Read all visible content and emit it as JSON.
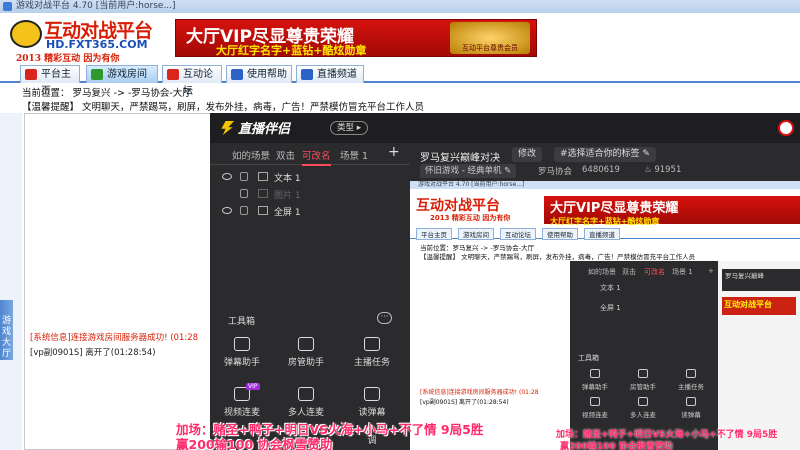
{
  "window": {
    "title": "游戏对战平台 4.70 [当前用户:horse...]"
  },
  "banner": {
    "logo_text": "互动对战平台",
    "logo_url": "HD.FXT365.COM",
    "logo_slogan": "2013 精彩互动 因为有你",
    "ad_line1": "大厅VIP尽显尊贵荣耀",
    "ad_line2": "大厅红字名字+蓝钻+酷炫勋章",
    "ad_badge": "互动平台尊贵会员"
  },
  "nav": {
    "tabs": [
      {
        "label": "平台主页",
        "color": "#d8261f"
      },
      {
        "label": "游戏房间",
        "color": "#2e9a2e",
        "active": true
      },
      {
        "label": "互动论坛",
        "color": "#d8261f"
      },
      {
        "label": "使用帮助",
        "color": "#2a62c6"
      },
      {
        "label": "直播频道",
        "color": "#2a62c6"
      }
    ]
  },
  "breadcrumb": "当前位置：  罗马复兴  ->  -罗马协会-大厅",
  "notice": "【温馨提醒】 文明聊天，严禁踢骂，刷屏，发布外挂，病毒，广告！严禁模仿冒充平台工作人员",
  "sidetab": "游戏大厅",
  "chat": {
    "system_msg": "[系统信息]连接游戏房间服务器成功! (01:28",
    "exit_msg": "[vp副0901S] 离开了(01:28:54)"
  },
  "overlay": {
    "app_name": "直播伴侣",
    "type_button": "类型 ▸",
    "scene_tabs": [
      "如的场景",
      "双击",
      "可改名",
      "场景 1"
    ],
    "add_scene": "+",
    "sources": [
      {
        "label": "文本 1",
        "dim": false
      },
      {
        "label": "图片 1",
        "dim": true
      },
      {
        "label": "全屏 1",
        "dim": false
      }
    ],
    "toolbox_label": "工具箱",
    "toolbox_more": "···",
    "tools": [
      "弹幕助手",
      "房管助手",
      "主播任务",
      "视频连麦",
      "多人连麦",
      "读弹幕",
      "",
      "",
      "调"
    ],
    "room_title": "罗马复兴巅峰对决",
    "edit_button": "修改",
    "tag_button": "#选择适合你的标签 ✎",
    "category_tag": "怀旧游戏 - 经典单机 ✎",
    "room_name": "罗马协会",
    "room_id": "6480619",
    "heat": "91951"
  },
  "preview": {
    "title": "游戏对战平台 4.70 [当前用户:horse...]",
    "logo": "互动对战平台",
    "logo_slogan": "2013 精彩互动 因为有你",
    "ad_line1": "大厅VIP尽显尊贵荣耀",
    "ad_line2": "大厅红字名字+蓝钻+酷炫勋章",
    "nav": [
      "平台主页",
      "游戏房间",
      "互动论坛",
      "使用帮助",
      "直播频道"
    ],
    "breadcrumb": "当前位置：罗马复兴 -> -罗马协会-大厅",
    "notice": "【温馨提醒】 文明聊天，严禁踢骂，刷屏，发布外挂，病毒，广告！严禁模仿冒充平台工作人员",
    "sys_msg": "[系统信息]连接游戏房间服务器成功! (01:28",
    "exit_msg": "[vp副0901S] 离开了(01:28:54)",
    "mini_tabs": [
      "如的场景",
      "双击",
      "可改名",
      "场景 1",
      "+"
    ],
    "mini_sources": [
      "文本 1",
      "全屏 1"
    ],
    "mini_toolbox": "工具箱",
    "mini_tools": [
      "弹幕助手",
      "房管助手",
      "主播任务",
      "视频连麦",
      "多人连麦",
      "读弹幕"
    ],
    "mini_room_title": "罗马复兴巅峰"
  },
  "captions": {
    "line1": "加场：赌圣+鸭子+明日VS火海+小马+不了情 9局5胜",
    "line2": "赢200输100 协会枫雪赞助",
    "small1": "加场：赌圣+鸭子+明日VS火海+小马+不了情 9局5胜",
    "small2": "赢200输100 协会枫雪赞助"
  }
}
